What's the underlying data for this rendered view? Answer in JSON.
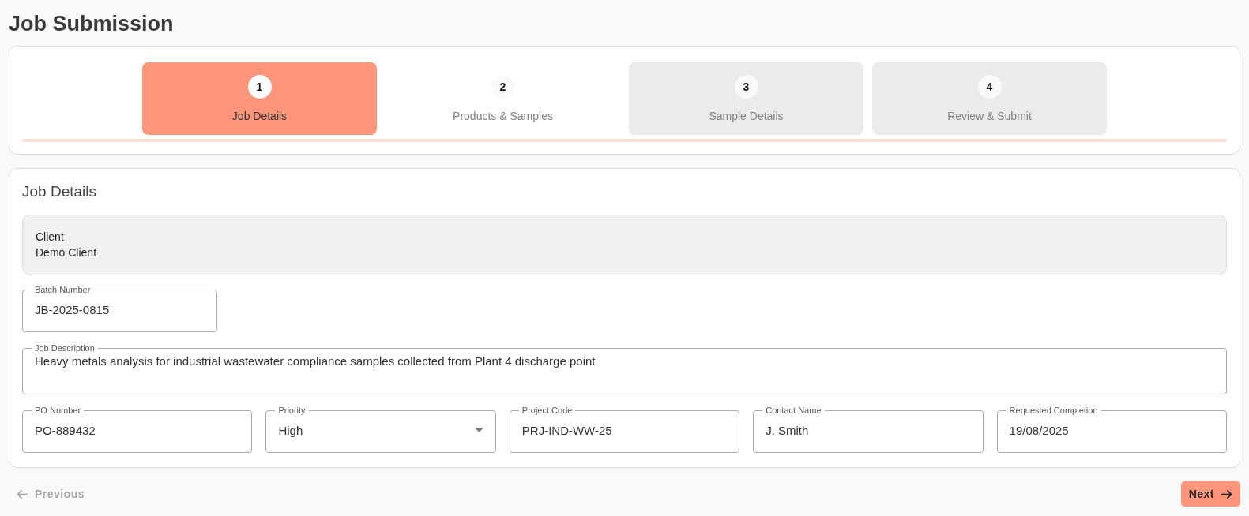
{
  "page": {
    "title": "Job Submission"
  },
  "steps": [
    {
      "number": "1",
      "label": "Job Details",
      "selected": true,
      "disabled": false
    },
    {
      "number": "2",
      "label": "Products & Samples",
      "selected": false,
      "disabled": false
    },
    {
      "number": "3",
      "label": "Sample Details",
      "selected": false,
      "disabled": true
    },
    {
      "number": "4",
      "label": "Review & Submit",
      "selected": false,
      "disabled": true
    }
  ],
  "form": {
    "title": "Job Details",
    "client": {
      "label": "Client",
      "value": "Demo Client"
    },
    "rows": [
      {
        "fields": [
          {
            "label": "Batch Number",
            "value": "JB-2025-0815",
            "kind": "text"
          }
        ]
      },
      {
        "fields": [
          {
            "label": "Job Description",
            "value": "Heavy metals analysis for industrial wastewater compliance samples collected from Plant 4 discharge point",
            "kind": "multiline"
          }
        ]
      },
      {
        "fields": [
          {
            "label": "PO Number",
            "value": "PO-889432",
            "kind": "text"
          },
          {
            "label": "Priority",
            "value": "High",
            "kind": "select"
          },
          {
            "label": "Project Code",
            "value": "PRJ-IND-WW-25",
            "kind": "text"
          },
          {
            "label": "Contact Name",
            "value": "J. Smith",
            "kind": "text"
          },
          {
            "label": "Requested Completion",
            "value": "19/08/2025",
            "kind": "text"
          }
        ]
      }
    ]
  },
  "footer": {
    "previous": {
      "label": "Previous",
      "disabled": true
    },
    "next": {
      "label": "Next",
      "disabled": false
    }
  }
}
